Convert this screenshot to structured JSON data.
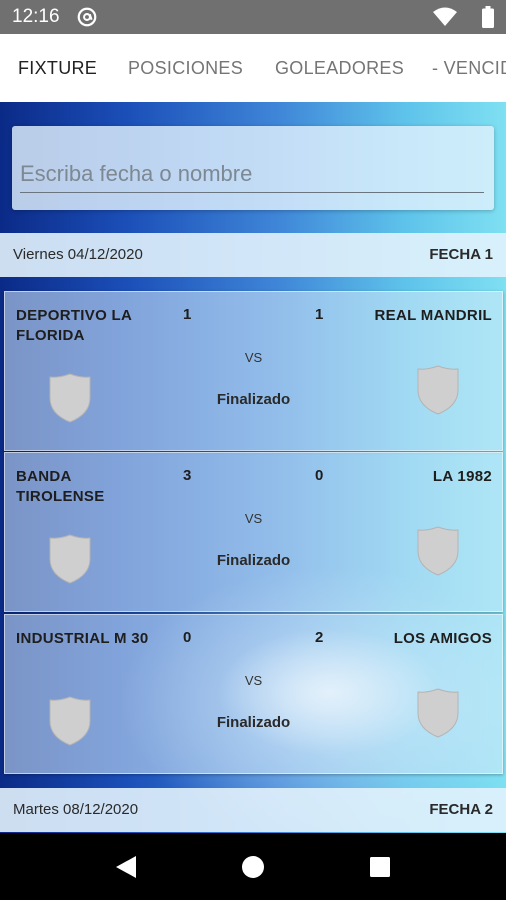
{
  "status_bar": {
    "time": "12:16",
    "icons": [
      "at-sign-icon",
      "wifi-icon",
      "battery-icon"
    ]
  },
  "tabs": [
    {
      "label": "FIXTURE",
      "active": true
    },
    {
      "label": "POSICIONES",
      "active": false
    },
    {
      "label": "GOLEADORES",
      "active": false
    },
    {
      "label": "- VENCID",
      "active": false
    }
  ],
  "search": {
    "placeholder": "Escriba fecha o nombre",
    "value": ""
  },
  "groups": [
    {
      "date": "Viernes 04/12/2020",
      "fecha": "FECHA 1",
      "matches": [
        {
          "home": "DEPORTIVO LA FLORIDA",
          "home_score": "1",
          "away_score": "1",
          "away": "REAL MANDRIL",
          "vs": "VS",
          "status": "Finalizado"
        },
        {
          "home": "BANDA TIROLENSE",
          "home_score": "3",
          "away_score": "0",
          "away": "LA 1982",
          "vs": "VS",
          "status": "Finalizado"
        },
        {
          "home": "INDUSTRIAL M 30",
          "home_score": "0",
          "away_score": "2",
          "away": "LOS AMIGOS",
          "vs": "VS",
          "status": "Finalizado"
        }
      ]
    },
    {
      "date": "Martes 08/12/2020",
      "fecha": "FECHA 2",
      "matches": []
    }
  ],
  "nav_bar": {
    "icons": [
      "back-icon",
      "home-icon",
      "recents-icon"
    ]
  },
  "colors": {
    "status_bar": "#707070",
    "tab_active": "#222222",
    "tab_inactive": "#757575",
    "background_dark": "#0b2a87",
    "background_light": "#7fe0f2"
  }
}
